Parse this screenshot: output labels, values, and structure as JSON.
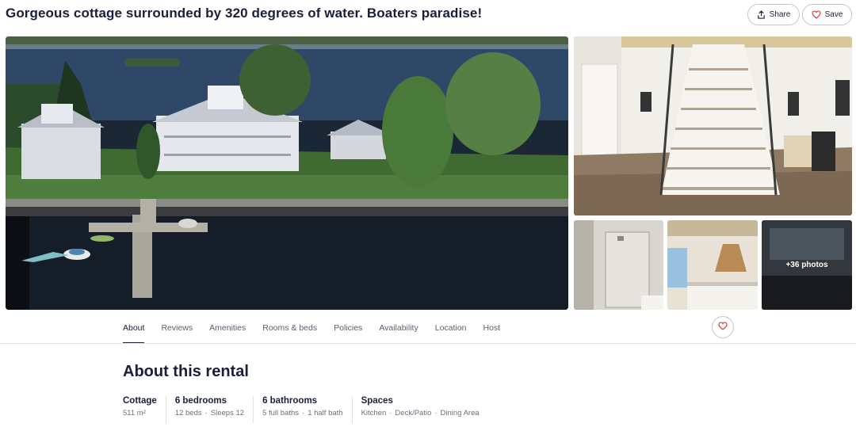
{
  "listing": {
    "title": "Gorgeous cottage surrounded by 320 degrees of water. Boaters paradise!"
  },
  "actions": {
    "share_label": "Share",
    "save_label": "Save",
    "share_icon": "share-icon",
    "save_icon": "heart-icon"
  },
  "gallery": {
    "more_photos_label": "+36 photos"
  },
  "tabs": [
    {
      "label": "About",
      "active": true
    },
    {
      "label": "Reviews"
    },
    {
      "label": "Amenities"
    },
    {
      "label": "Rooms & beds"
    },
    {
      "label": "Policies"
    },
    {
      "label": "Availability"
    },
    {
      "label": "Location"
    },
    {
      "label": "Host"
    }
  ],
  "about": {
    "heading": "About this rental",
    "facts": [
      {
        "title": "Cottage",
        "details": [
          "511 m²"
        ]
      },
      {
        "title": "6 bedrooms",
        "details": [
          "12 beds",
          "Sleeps 12"
        ]
      },
      {
        "title": "6 bathrooms",
        "details": [
          "5 full baths",
          "1 half bath"
        ]
      },
      {
        "title": "Spaces",
        "details": [
          "Kitchen",
          "Deck/Patio",
          "Dining Area"
        ]
      }
    ]
  },
  "colors": {
    "text_primary": "#191e3b",
    "accent_heart": "#d32f2f",
    "border": "#c4c6ce"
  }
}
